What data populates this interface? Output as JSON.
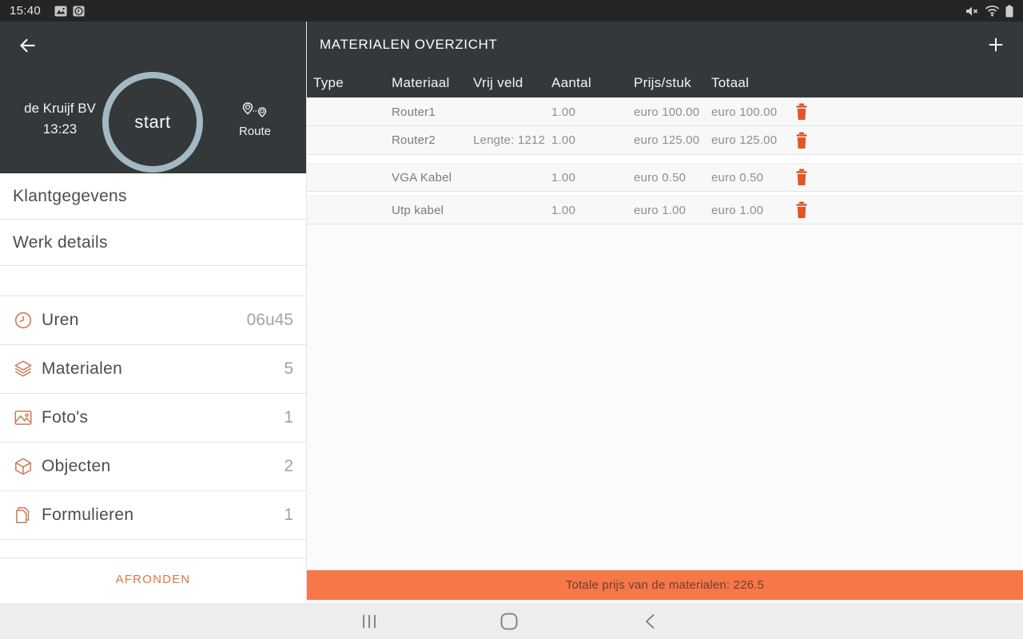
{
  "colors": {
    "dark_header": "#35383b",
    "status_bar": "#232527",
    "accent_orange": "#e35426",
    "icon_orange": "#cd7b5a",
    "total_bar_orange": "#f5774a",
    "start_ring": "#a3b9c3"
  },
  "status_bar": {
    "time": "15:40"
  },
  "app_bar": {
    "title": "MATERIALEN OVERZICHT"
  },
  "sidebar": {
    "company": "de Kruijf BV",
    "clock": "13:23",
    "start_label": "start",
    "route_label": "Route",
    "simple_items": [
      {
        "label": "Klantgegevens"
      },
      {
        "label": "Werk details"
      }
    ],
    "count_items": [
      {
        "icon": "clock-icon",
        "label": "Uren",
        "value": "06u45"
      },
      {
        "icon": "layers-icon",
        "label": "Materialen",
        "value": "5"
      },
      {
        "icon": "photo-icon",
        "label": "Foto's",
        "value": "1"
      },
      {
        "icon": "cube-icon",
        "label": "Objecten",
        "value": "2"
      },
      {
        "icon": "document-icon",
        "label": "Formulieren",
        "value": "1"
      }
    ],
    "finish_label": "AFRONDEN"
  },
  "table": {
    "columns": [
      "Type",
      "Materiaal",
      "Vrij veld",
      "Aantal",
      "Prijs/stuk",
      "Totaal"
    ],
    "groups": [
      {
        "rows": [
          {
            "type": "",
            "materiaal": "Router1",
            "vrij_veld": "",
            "aantal": "1.00",
            "prijs_stuk": "euro 100.00",
            "totaal": "euro 100.00"
          },
          {
            "type": "",
            "materiaal": "Router2",
            "vrij_veld": "Lengte: 1212",
            "aantal": "1.00",
            "prijs_stuk": "euro 125.00",
            "totaal": "euro 125.00"
          }
        ]
      },
      {
        "rows": [
          {
            "type": "",
            "materiaal": "VGA Kabel",
            "vrij_veld": "",
            "aantal": "1.00",
            "prijs_stuk": "euro 0.50",
            "totaal": "euro 0.50"
          }
        ]
      },
      {
        "rows": [
          {
            "type": "",
            "materiaal": "Utp kabel",
            "vrij_veld": "",
            "aantal": "1.00",
            "prijs_stuk": "euro 1.00",
            "totaal": "euro 1.00"
          }
        ]
      }
    ]
  },
  "total_bar": {
    "label": "Totale prijs van de materialen: 226.5"
  }
}
